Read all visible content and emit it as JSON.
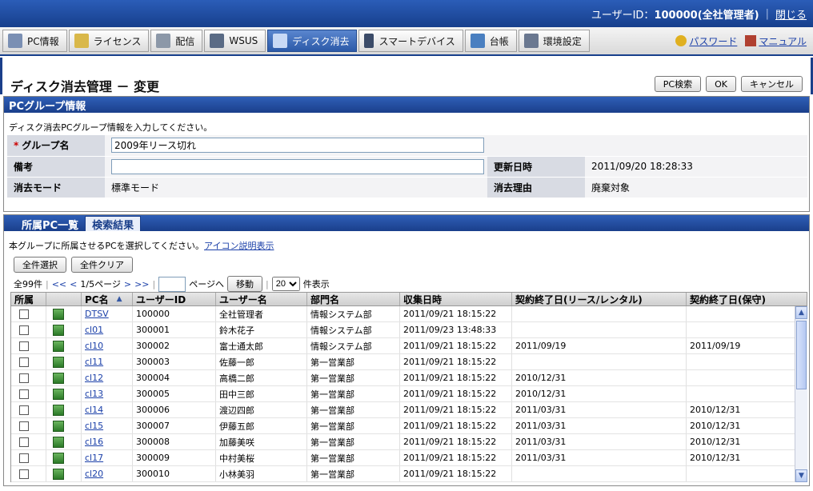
{
  "topbar": {
    "uid_label": "ユーザーID：",
    "uid_value": "100000(全社管理者)",
    "close_label": "閉じる"
  },
  "nav": {
    "tabs": [
      {
        "label": "PC情報",
        "icon": "pc-icon",
        "color": "#7a8fb3"
      },
      {
        "label": "ライセンス",
        "icon": "license-icon",
        "color": "#d9b84a"
      },
      {
        "label": "配信",
        "icon": "distribution-icon",
        "color": "#8c98a8"
      },
      {
        "label": "WSUS",
        "icon": "wsus-icon",
        "color": "#5a6b85"
      },
      {
        "label": "ディスク消去",
        "icon": "disk-erase-icon",
        "color": "#c9d9f5"
      },
      {
        "label": "スマートデバイス",
        "icon": "smart-device-icon",
        "color": "#3b4b68"
      },
      {
        "label": "台帳",
        "icon": "ledger-icon",
        "color": "#4a7fc0"
      },
      {
        "label": "環境設定",
        "icon": "settings-icon",
        "color": "#6a7890"
      }
    ],
    "password_label": "パスワード",
    "manual_label": "マニュアル"
  },
  "page": {
    "title": "ディスク消去管理 － 変更",
    "pc_search_label": "PC検索",
    "ok_label": "OK",
    "cancel_label": "キャンセル"
  },
  "group": {
    "header": "PCグループ情報",
    "note": "ディスク消去PCグループ情報を入力してください。",
    "name_label": "グループ名",
    "name_value": "2009年リース切れ",
    "remark_label": "備考",
    "remark_value": "",
    "updated_label": "更新日時",
    "updated_value": "2011/09/20 18:28:33",
    "mode_label": "消去モード",
    "mode_value": "標準モード",
    "reason_label": "消去理由",
    "reason_value": "廃棄対象"
  },
  "list": {
    "tabs": [
      "所属PC一覧",
      "検索結果"
    ],
    "note": "本グループに所属させるPCを選択してください。",
    "icon_help": "アイコン説明表示",
    "select_all": "全件選択",
    "clear_all": "全件クリア",
    "total": "全99件",
    "page_info": "1/5ページ",
    "first": "<<",
    "prev": "<",
    "next": ">",
    "last": ">>",
    "page_suffix": "ページへ",
    "move_label": "移動",
    "per_page": "20",
    "per_page_suffix": "件表示",
    "columns": [
      "所属",
      "",
      "PC名",
      "ユーザーID",
      "ユーザー名",
      "部門名",
      "収集日時",
      "契約終了日(リース/レンタル)",
      "契約終了日(保守)"
    ],
    "rows": [
      {
        "pc": "DTSV",
        "uid": "100000",
        "user": "全社管理者",
        "dept": "情報システム部",
        "date": "2011/09/21 18:15:22",
        "lease": "",
        "maint": ""
      },
      {
        "pc": "cl01",
        "uid": "300001",
        "user": "鈴木花子",
        "dept": "情報システム部",
        "date": "2011/09/23 13:48:33",
        "lease": "",
        "maint": ""
      },
      {
        "pc": "cl10",
        "uid": "300002",
        "user": "富士通太郎",
        "dept": "情報システム部",
        "date": "2011/09/21 18:15:22",
        "lease": "2011/09/19",
        "maint": "2011/09/19"
      },
      {
        "pc": "cl11",
        "uid": "300003",
        "user": "佐藤一郎",
        "dept": "第一営業部",
        "date": "2011/09/21 18:15:22",
        "lease": "",
        "maint": ""
      },
      {
        "pc": "cl12",
        "uid": "300004",
        "user": "高橋二郎",
        "dept": "第一営業部",
        "date": "2011/09/21 18:15:22",
        "lease": "2010/12/31",
        "maint": ""
      },
      {
        "pc": "cl13",
        "uid": "300005",
        "user": "田中三郎",
        "dept": "第一営業部",
        "date": "2011/09/21 18:15:22",
        "lease": "2010/12/31",
        "maint": ""
      },
      {
        "pc": "cl14",
        "uid": "300006",
        "user": "渡辺四郎",
        "dept": "第一営業部",
        "date": "2011/09/21 18:15:22",
        "lease": "2011/03/31",
        "maint": "2010/12/31"
      },
      {
        "pc": "cl15",
        "uid": "300007",
        "user": "伊藤五郎",
        "dept": "第一営業部",
        "date": "2011/09/21 18:15:22",
        "lease": "2011/03/31",
        "maint": "2010/12/31"
      },
      {
        "pc": "cl16",
        "uid": "300008",
        "user": "加藤美咲",
        "dept": "第一営業部",
        "date": "2011/09/21 18:15:22",
        "lease": "2011/03/31",
        "maint": "2010/12/31"
      },
      {
        "pc": "cl17",
        "uid": "300009",
        "user": "中村美桜",
        "dept": "第一営業部",
        "date": "2011/09/21 18:15:22",
        "lease": "2011/03/31",
        "maint": "2010/12/31"
      },
      {
        "pc": "cl20",
        "uid": "300010",
        "user": "小林美羽",
        "dept": "第一営業部",
        "date": "2011/09/21 18:15:22",
        "lease": "",
        "maint": ""
      }
    ]
  }
}
